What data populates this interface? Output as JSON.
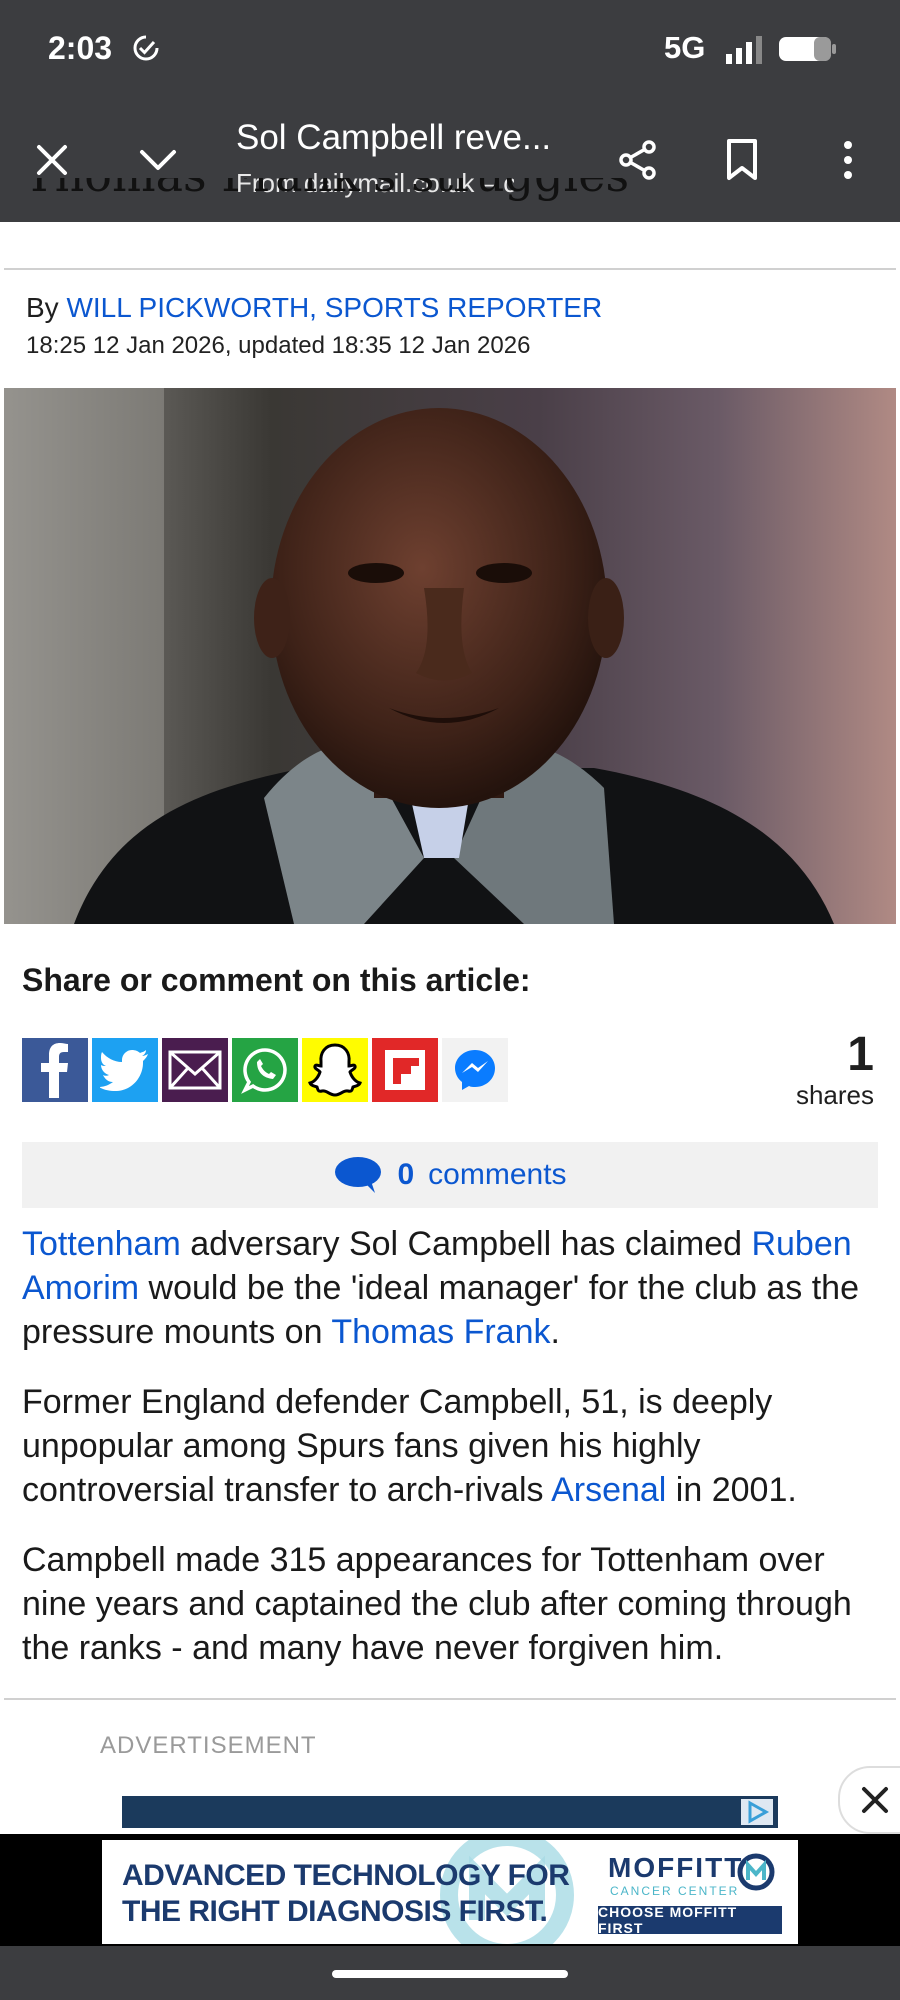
{
  "status_bar": {
    "time": "2:03",
    "network": "5G",
    "check_icon": "check-circle-icon",
    "signal_icon": "signal-icon",
    "battery_icon": "battery-icon"
  },
  "tab_header": {
    "title": "Sol Campbell reve...",
    "url": "From dailymail.co.uk – c",
    "close_icon": "close-icon",
    "collapse_icon": "chevron-down-icon",
    "share_icon": "share-icon",
    "bookmark_icon": "bookmark-icon",
    "menu_icon": "more-vert-icon"
  },
  "article": {
    "cut_heading": "Thomas Frank's struggles",
    "byline_prefix": "By",
    "author": "WILL PICKWORTH, SPORTS REPORTER",
    "dateline": "18:25 12 Jan 2026, updated 18:35 12 Jan 2026",
    "share_title": "Share or comment on this article:",
    "share_icons": [
      "facebook-icon",
      "twitter-icon",
      "email-icon",
      "whatsapp-icon",
      "snapchat-icon",
      "flipboard-icon",
      "messenger-icon"
    ],
    "share_count": "1",
    "share_label": "shares",
    "comments_count": "0",
    "comments_label": "comments",
    "p1": {
      "link1": "Tottenham",
      "t1": " adversary Sol Campbell has claimed ",
      "link2": "Ruben Amorim",
      "t2": " would be the 'ideal manager' for the club as the pressure mounts on ",
      "link3": "Thomas Frank",
      "t3": "."
    },
    "p2": {
      "t1": "Former England defender Campbell, 51, is deeply unpopular among Spurs fans given his highly controversial transfer to arch-rivals ",
      "link1": "Arsenal",
      "t2": " in 2001."
    },
    "p3": "Campbell made 315 appearances for Tottenham over nine years and captained the club after coming through the ranks - and many have never forgiven him."
  },
  "ad": {
    "label": "ADVERTISEMENT",
    "banner_line1": "ADVANCED TECHNOLOGY FOR",
    "banner_line2": "THE RIGHT DIAGNOSIS FIRST.",
    "brand": "MOFFITT",
    "brand_sub": "CANCER CENTER",
    "cta": "CHOOSE MOFFITT FIRST"
  },
  "colors": {
    "chrome": "#3c3d40",
    "link": "#0b57d0",
    "ad_navy": "#1b3a6e"
  }
}
